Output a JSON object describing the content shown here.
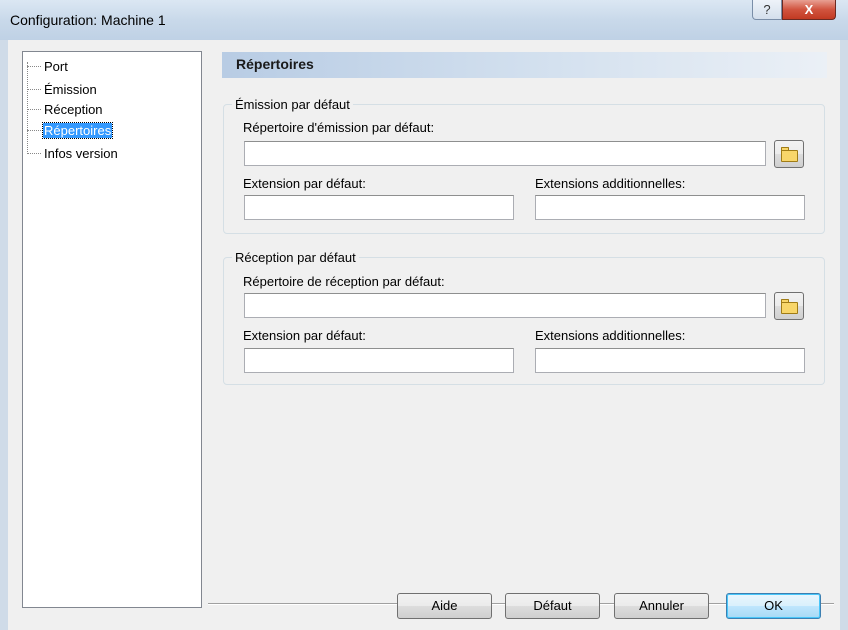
{
  "window": {
    "title": "Configuration: Machine 1",
    "help_glyph": "?",
    "close_glyph": "X"
  },
  "tree": {
    "items": [
      {
        "label": "Port",
        "selected": false
      },
      {
        "label": "Émission",
        "selected": false
      },
      {
        "label": "Réception",
        "selected": false
      },
      {
        "label": "Répertoires",
        "selected": true
      },
      {
        "label": "Infos version",
        "selected": false
      }
    ]
  },
  "panel": {
    "title": "Répertoires"
  },
  "emission_group": {
    "title": "Émission par défaut",
    "dir_label": "Répertoire d'émission par défaut:",
    "dir_value": "",
    "ext_label": "Extension par défaut:",
    "ext_value": "",
    "extra_label": "Extensions additionnelles:",
    "extra_value": ""
  },
  "reception_group": {
    "title": "Réception par défaut",
    "dir_label": "Répertoire de réception par défaut:",
    "dir_value": "",
    "ext_label": "Extension par défaut:",
    "ext_value": "",
    "extra_label": "Extensions additionnelles:",
    "extra_value": ""
  },
  "buttons": {
    "help": "Aide",
    "default": "Défaut",
    "cancel": "Annuler",
    "ok": "OK"
  },
  "colors": {
    "selection": "#3399ff",
    "header_gradient_start": "#b8cce4",
    "close_button": "#c23a22"
  },
  "icons": {
    "folder": "folder-icon"
  }
}
